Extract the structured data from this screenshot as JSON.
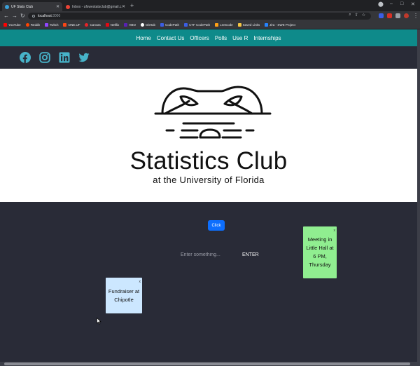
{
  "browser": {
    "tabs": [
      {
        "title": "UF Stats Club",
        "active": true
      },
      {
        "title": "Inbox - ufswestatsclub@gmail.c...",
        "active": false
      }
    ],
    "new_tab": "+",
    "url_host": "localhost",
    "url_port": ":3000",
    "window_controls": {
      "minimize": "–",
      "maximize": "□",
      "close": "✕"
    },
    "bookmarks": [
      {
        "label": "YouTube",
        "color": "#ff0000"
      },
      {
        "label": "Reddit",
        "color": "#ff4500"
      },
      {
        "label": "Twitch",
        "color": "#9146ff"
      },
      {
        "label": "ONE.UF",
        "color": "#fa4616"
      },
      {
        "label": "Canvas",
        "color": "#e72429"
      },
      {
        "label": "Netflix",
        "color": "#e50914"
      },
      {
        "label": "HBO",
        "color": "#5822b4"
      },
      {
        "label": "GitHub",
        "color": "#ffffff"
      },
      {
        "label": "CodePath",
        "color": "#3b5ee4"
      },
      {
        "label": "CTF CodePath",
        "color": "#3b5ee4"
      },
      {
        "label": "Leetcode",
        "color": "#ffa116"
      },
      {
        "label": "Saved Links",
        "color": "#f4c542"
      },
      {
        "label": "Jira - SWE Project",
        "color": "#2684ff"
      }
    ]
  },
  "nav": {
    "items": [
      "Home",
      "Contact Us",
      "Officers",
      "Polls",
      "Use R",
      "Internships"
    ],
    "color": "#0e8a8a"
  },
  "social": [
    "facebook-icon",
    "instagram-icon",
    "linkedin-icon",
    "twitter-icon"
  ],
  "hero": {
    "title": "Statistics Club",
    "subtitle": "at the University of Florida"
  },
  "actions": {
    "click_label": "Click",
    "input_placeholder": "Enter something...",
    "enter_label": "ENTER"
  },
  "notes": [
    {
      "text": "Meeting in Little Hall at 6 PM, Thursday",
      "color": "#90ee90",
      "close": "x"
    },
    {
      "text": "Fundraiser at Chipotle",
      "color": "#cce7ff",
      "close": "x"
    }
  ]
}
